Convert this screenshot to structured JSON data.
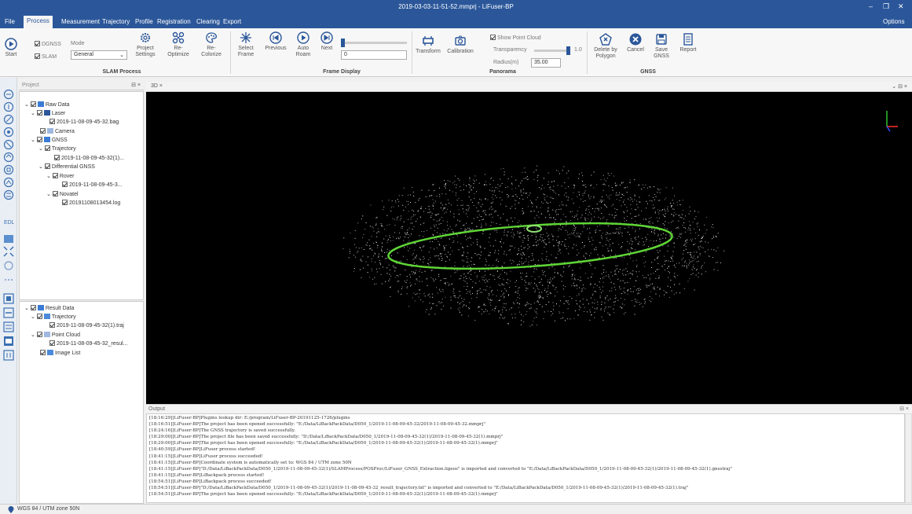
{
  "window": {
    "title": "2019-03-03-11-51-52.mmprj - LiFuser-BP",
    "options_label": "Options",
    "minimize_glyph": "–",
    "restore_glyph": "❐",
    "close_glyph": "✕"
  },
  "menu": {
    "tabs": [
      "File",
      "Process",
      "Measurement",
      "Trajectory",
      "Profile",
      "Registration",
      "Clearing",
      "Export"
    ],
    "active": "Process"
  },
  "ribbon": {
    "slam_process": {
      "start": "Start",
      "dgnss": "DGNSS",
      "slam": "SLAM",
      "mode_label": "Mode",
      "mode_value": "General",
      "project_settings": [
        "Project",
        "Settings"
      ],
      "reoptimize": [
        "Re-",
        "Optimize"
      ],
      "recolorize": [
        "Re-",
        "Colorize"
      ],
      "group": "SLAM Process"
    },
    "frame_display": {
      "select_frame": [
        "Select",
        "Frame"
      ],
      "previous": "Previous",
      "auto_roam": [
        "Auto",
        "Roam"
      ],
      "next": "Next",
      "frame_value": "0",
      "group": "Frame Display"
    },
    "panorama": {
      "transform": "Transform",
      "calibration": "Calibration",
      "show_point_cloud": "Show Point Cloud",
      "transparency_label": "Transparency",
      "transparency_value": "1.0",
      "radius_label": "Radius(m)",
      "radius_value": "35.00",
      "group": "Panorama"
    },
    "gnss": {
      "delete_by_polygon": [
        "Delete by",
        "Polygon"
      ],
      "cancel": "Cancel",
      "save_gnss": [
        "Save",
        "GNSS"
      ],
      "group": "GNSS"
    },
    "report": "Report"
  },
  "project_panel": {
    "title": "Project",
    "raw_tree": [
      {
        "label": "Raw Data",
        "level": 0
      },
      {
        "label": "Laser",
        "level": 1
      },
      {
        "label": "2019-11-08-09-45-32.bag",
        "level": 2
      },
      {
        "label": "Camera",
        "level": 1
      },
      {
        "label": "GNSS",
        "level": 1
      },
      {
        "label": "Trajectory",
        "level": 2
      },
      {
        "label": "2019-11-08-09-45-32(1)...",
        "level": 3
      },
      {
        "label": "Differential GNSS",
        "level": 2
      },
      {
        "label": "Rover",
        "level": 3
      },
      {
        "label": "2019-11-08-09-45-3...",
        "level": 4
      },
      {
        "label": "Novatel",
        "level": 3
      },
      {
        "label": "20191108013454.log",
        "level": 4
      }
    ],
    "result_tree": [
      {
        "label": "Result Data",
        "level": 0
      },
      {
        "label": "Trajectory",
        "level": 1
      },
      {
        "label": "2019-11-08-09-45-32(1).traj",
        "level": 2
      },
      {
        "label": "Point Cloud",
        "level": 1
      },
      {
        "label": "2019-11-08-09-45-32_resul...",
        "level": 2
      },
      {
        "label": "Image List",
        "level": 1
      }
    ]
  },
  "view": {
    "tab": "3D"
  },
  "output": {
    "title": "Output",
    "lines": [
      "[18:16:29][LiFuser-BP]Plugins lookup dir: E:/program/LiFuser-BP-20191125-1726/plugins",
      "[18:16:51][LiFuser-BP]The project has been opened successfully: \"E:/Data/LiBackPackData/D050_1/2019-11-08-09-45-32/2019-11-08-09-45-32.mmprj\"",
      "[18:24:16][LiFuser-BP]The GNSS trajectory is saved successfully.",
      "[18:29:00][LiFuser-BP]The project file has been saved successfully: \"D:/Data/LiBackPackData/D050_1/2019-11-08-09-45-32(1)/2019-11-08-09-45-32(1).mmprj\"",
      "[18:29:00][LiFuser-BP]The project has been opened successfully: \"E:/Data/LiBackPackData/D050_1/2019-11-08-09-45-32(1)/2019-11-08-09-45-32(1).mmprj\"",
      "[18:40:59][LiFuser-BP]LiFuser process started!",
      "[18:41:15][LiFuser-BP]LiFuser process succeeded!",
      "[18:41:15][LiFuser-BP]Coordinate system is automatically set to: WGS 84 / UTM zone 50N",
      "[18:41:15][LiFuser-BP]\"D:/Data/LiBackPackData/D050_1/2019-11-08-09-45-32(1)/SLAMProcess/POSProc/LiFuser_GNSS_Extraction.ligeos\" is imported and converted to \"E:/Data/LiBackPackData/D050_1/2019-11-08-09-45-32(1)/2019-11-08-09-45-32(1).gnsstraj\"",
      "[18:41:15][LiFuser-BP]LiBackpack process started!",
      "[18:54:51][LiFuser-BP]LiBackpack process succeeded!",
      "[18:54:51][LiFuser-BP]\"D:/Data/LiBackPackData/D050_1/2019-11-08-09-45-32(1)/2019-11-08-09-45-32_result_trajectory.txt\" is imported and converted to \"E:/Data/LiBackPackData/D050_1/2019-11-08-09-45-32(1)/2019-11-08-09-45-32(1).traj\"",
      "[18:54:51][LiFuser-BP]The project has been opened successfully: \"E:/Data/LiBackPackData/D050_1/2019-11-08-09-45-32(1)/2019-11-08-09-45-32(1).mmprj\""
    ]
  },
  "status": {
    "coordinate_system": "WGS 84 / UTM zone 50N"
  },
  "colors": {
    "accent": "#2b579a",
    "trajectory": "#5fd536",
    "axis_x": "#ff3030",
    "axis_y": "#30c030",
    "axis_z": "#3050ff"
  }
}
